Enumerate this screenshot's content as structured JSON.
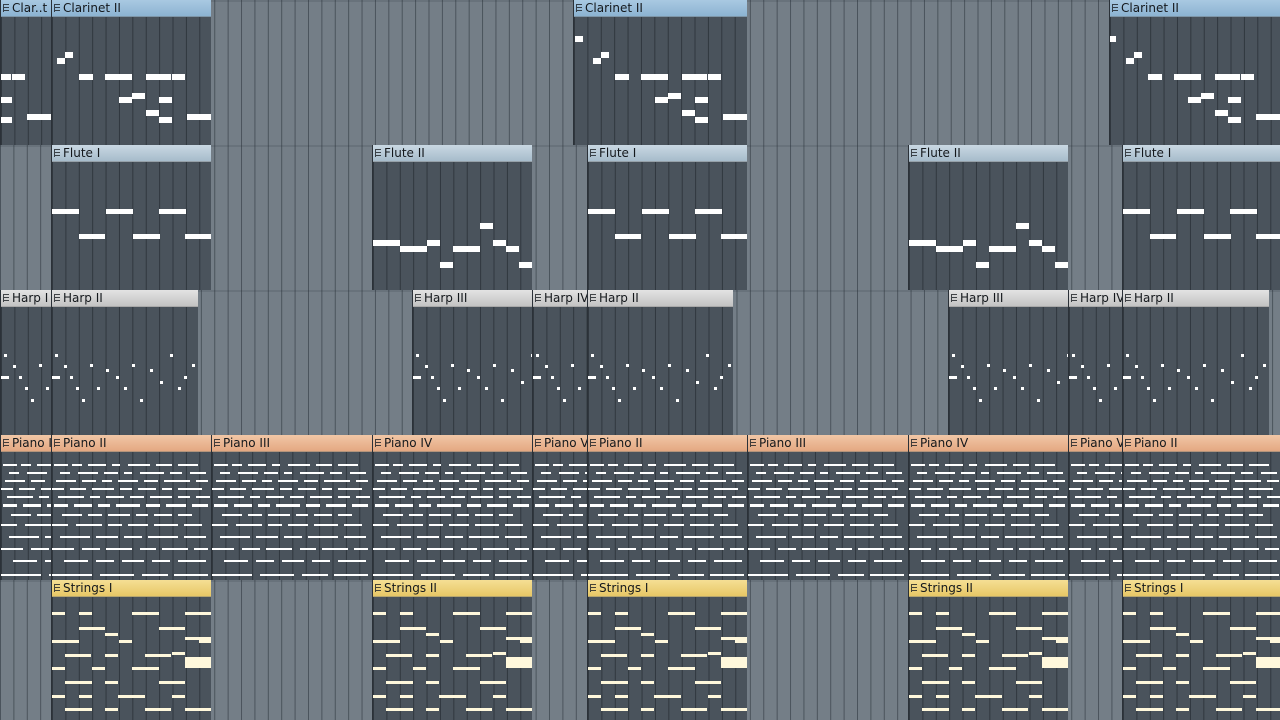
{
  "arrange": {
    "tracks": [
      {
        "id": "clarinet",
        "regions": [
          {
            "name": "Clar..t I",
            "pattern": "clarinet"
          },
          {
            "name": "Clarinet II",
            "pattern": "clarinet"
          },
          {
            "name": "Clarinet II",
            "pattern": "clarinet"
          },
          {
            "name": "Clarinet II",
            "pattern": "clarinet"
          }
        ]
      },
      {
        "id": "flute",
        "regions": [
          {
            "name": "Flute I",
            "pattern": "flute1"
          },
          {
            "name": "Flute II",
            "pattern": "flute2"
          },
          {
            "name": "Flute I",
            "pattern": "flute1"
          },
          {
            "name": "Flute II",
            "pattern": "flute2"
          },
          {
            "name": "Flute I",
            "pattern": "flute1"
          }
        ]
      },
      {
        "id": "harp",
        "regions": [
          {
            "name": "Harp I",
            "pattern": "harp"
          },
          {
            "name": "Harp II",
            "pattern": "harp"
          },
          {
            "name": "Harp III",
            "pattern": "harp"
          },
          {
            "name": "Harp IV",
            "pattern": "harp"
          },
          {
            "name": "Harp II",
            "pattern": "harp"
          },
          {
            "name": "Harp III",
            "pattern": "harp"
          },
          {
            "name": "Harp IV",
            "pattern": "harp"
          },
          {
            "name": "Harp II",
            "pattern": "harp"
          }
        ]
      },
      {
        "id": "piano",
        "regions": [
          {
            "name": "Piano I",
            "pattern": "piano"
          },
          {
            "name": "Piano II",
            "pattern": "piano"
          },
          {
            "name": "Piano III",
            "pattern": "piano"
          },
          {
            "name": "Piano IV",
            "pattern": "piano"
          },
          {
            "name": "Piano V",
            "pattern": "piano"
          },
          {
            "name": "Piano II",
            "pattern": "piano"
          },
          {
            "name": "Piano III",
            "pattern": "piano"
          },
          {
            "name": "Piano IV",
            "pattern": "piano"
          },
          {
            "name": "Piano V",
            "pattern": "piano"
          },
          {
            "name": "Piano II",
            "pattern": "piano"
          }
        ]
      },
      {
        "id": "strings",
        "regions": [
          {
            "name": "Strings I",
            "pattern": "strings"
          },
          {
            "name": "Strings II",
            "pattern": "strings"
          },
          {
            "name": "Strings I",
            "pattern": "strings"
          },
          {
            "name": "Strings II",
            "pattern": "strings"
          },
          {
            "name": "Strings I",
            "pattern": "strings"
          }
        ]
      }
    ]
  }
}
